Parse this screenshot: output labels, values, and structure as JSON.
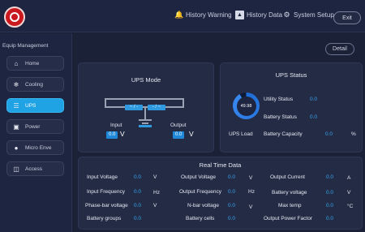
{
  "header": {
    "logo_text": "",
    "nav": [
      {
        "label": "History Warning",
        "icon": "bell-icon"
      },
      {
        "label": "History Data",
        "icon": "chart-icon"
      },
      {
        "label": "System Setup",
        "icon": "gear-icon"
      }
    ],
    "exit_label": "Exit"
  },
  "sidebar": {
    "title": "Equip Management",
    "items": [
      {
        "label": "Home",
        "icon": "home-icon",
        "active": false
      },
      {
        "label": "Cooling",
        "icon": "snowflake-icon",
        "active": false
      },
      {
        "label": "UPS",
        "icon": "ups-icon",
        "active": true
      },
      {
        "label": "Power",
        "icon": "power-icon",
        "active": false
      },
      {
        "label": "Micro Enve",
        "icon": "drop-icon",
        "active": false
      },
      {
        "label": "Access",
        "icon": "access-icon",
        "active": false
      }
    ]
  },
  "main": {
    "detail_label": "Detail",
    "ups_mode": {
      "title": "UPS Mode",
      "module1": "~ / -",
      "module2": "- / ~",
      "input_label": "Input",
      "input_value": "0.0",
      "output_label": "Output",
      "output_value": "0.0",
      "unit": "V"
    },
    "ups_status": {
      "title": "UPS Status",
      "load_value": "49.98",
      "load_percent": 92,
      "load_label": "UPS Load",
      "utility_label": "Utility Status",
      "utility_value": "0.0",
      "battery_status_label": "Battery Status",
      "battery_status_value": "0.0",
      "battery_capacity_label": "Battery Capacity",
      "battery_capacity_value": "0.0",
      "battery_capacity_unit": "%"
    },
    "realtime": {
      "title": "Real Time Data",
      "rows": [
        [
          {
            "label": "Input Voltage",
            "value": "0.0",
            "unit": "V"
          },
          {
            "label": "Output Voltage",
            "value": "0.0",
            "unit": "V"
          },
          {
            "label": "Output Current",
            "value": "0.0",
            "unit": "A"
          }
        ],
        [
          {
            "label": "Input Frequency",
            "value": "0.0",
            "unit": "Hz"
          },
          {
            "label": "Output Frequency",
            "value": "0.0",
            "unit": "Hz"
          },
          {
            "label": "Battery voltage",
            "value": "0.0",
            "unit": "V"
          }
        ],
        [
          {
            "label": "Phase-bar voltage",
            "value": "0.0",
            "unit": "V"
          },
          {
            "label": "N-bar voltage",
            "value": "0.0",
            "unit": "V"
          },
          {
            "label": "Max temp",
            "value": "0.0",
            "unit": "°C"
          }
        ],
        [
          {
            "label": "Battery groups",
            "value": "0.0",
            "unit": ""
          },
          {
            "label": "Battery cells",
            "value": "0.0",
            "unit": ""
          },
          {
            "label": "Output Power Factor",
            "value": "0.0",
            "unit": ""
          }
        ]
      ]
    }
  },
  "colors": {
    "background": "#1b2238",
    "panel": "#242b45",
    "accent": "#1fa3e5",
    "value": "#35a6f0",
    "logo": "#c9191f"
  }
}
